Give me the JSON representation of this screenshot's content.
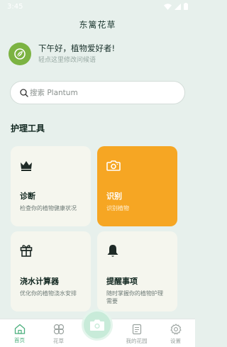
{
  "status_bar": {
    "time": "3:45"
  },
  "app": {
    "title": "东篱花草"
  },
  "greeting": {
    "headline": "下午好，植物爱好者!",
    "subtitle": "轻点这里修改问候语"
  },
  "search": {
    "placeholder": "搜索 Plantum"
  },
  "section": {
    "title": "护理工具"
  },
  "cards": [
    {
      "title": "诊断",
      "desc": "检查你的植物健康状况",
      "icon": "crown-icon",
      "accent": "#f5f6ee"
    },
    {
      "title": "识别",
      "desc": "识别植物",
      "icon": "camera-icon",
      "accent": "#f6a623"
    },
    {
      "title": "浇水计算器",
      "desc": "优化你的植物浇水安排",
      "icon": "gift-icon",
      "accent": "#f5f6ee"
    },
    {
      "title": "提醒事项",
      "desc": "随时掌握你的植物护理需要",
      "icon": "bell-icon",
      "accent": "#f5f6ee"
    }
  ],
  "nav": {
    "items": [
      {
        "label": "首页",
        "icon": "home-icon",
        "active": true
      },
      {
        "label": "花草",
        "icon": "clover-icon",
        "active": false
      },
      {
        "label": "",
        "icon": "camera-icon",
        "active": false
      },
      {
        "label": "我的花园",
        "icon": "document-icon",
        "active": false
      },
      {
        "label": "设置",
        "icon": "gear-icon",
        "active": false
      }
    ]
  },
  "colors": {
    "background": "#e7f0ec",
    "accent_orange": "#f6a623",
    "nav_active": "#4caf7d",
    "avatar_green": "#7cb342"
  }
}
